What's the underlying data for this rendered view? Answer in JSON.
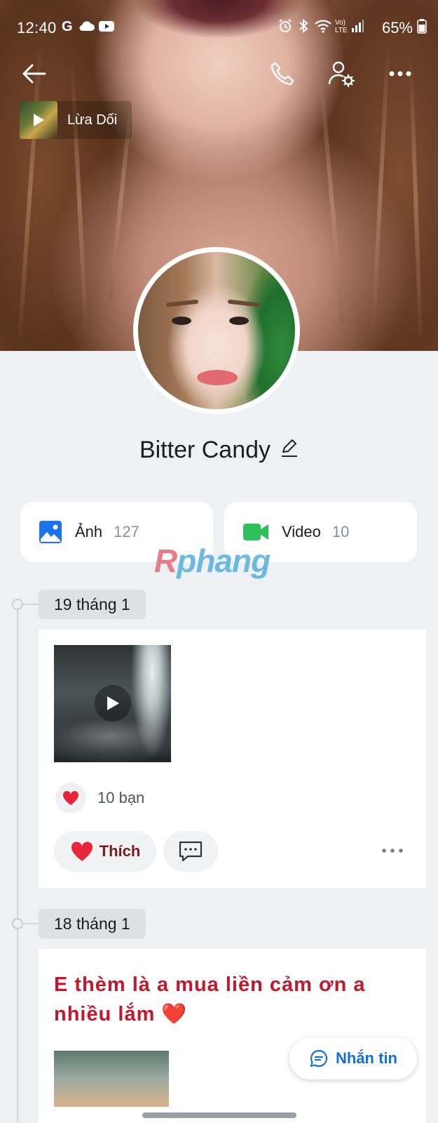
{
  "status_bar": {
    "time": "12:40",
    "battery_percent": "65%",
    "left_icons": [
      "google-icon",
      "cloud-icon",
      "youtube-icon"
    ],
    "right_icons": [
      "alarm-icon",
      "bluetooth-icon",
      "wifi-icon",
      "volte-icon",
      "signal-icon",
      "battery-icon"
    ]
  },
  "music": {
    "title": "Lừa Dối"
  },
  "profile": {
    "name": "Bitter Candy"
  },
  "media_tiles": [
    {
      "label": "Ảnh",
      "count": "127",
      "icon": "image-icon",
      "color": "#1a73e8"
    },
    {
      "label": "Video",
      "count": "10",
      "icon": "video-icon",
      "color": "#2fbf5b"
    }
  ],
  "watermark": {
    "part1": "R",
    "part2": "phang"
  },
  "timeline": [
    {
      "date": "19 tháng 1",
      "reaction_count": "10 bạn",
      "like_label": "Thích"
    },
    {
      "date": "18 tháng 1",
      "text": "E thèm là a mua liền cảm ơn a nhiều lắm ❤️"
    }
  ],
  "message_button": {
    "label": "Nhắn tin"
  },
  "colors": {
    "accent_blue": "#1470d8",
    "like_red": "#e8263a",
    "page_bg": "#eef1f4"
  }
}
